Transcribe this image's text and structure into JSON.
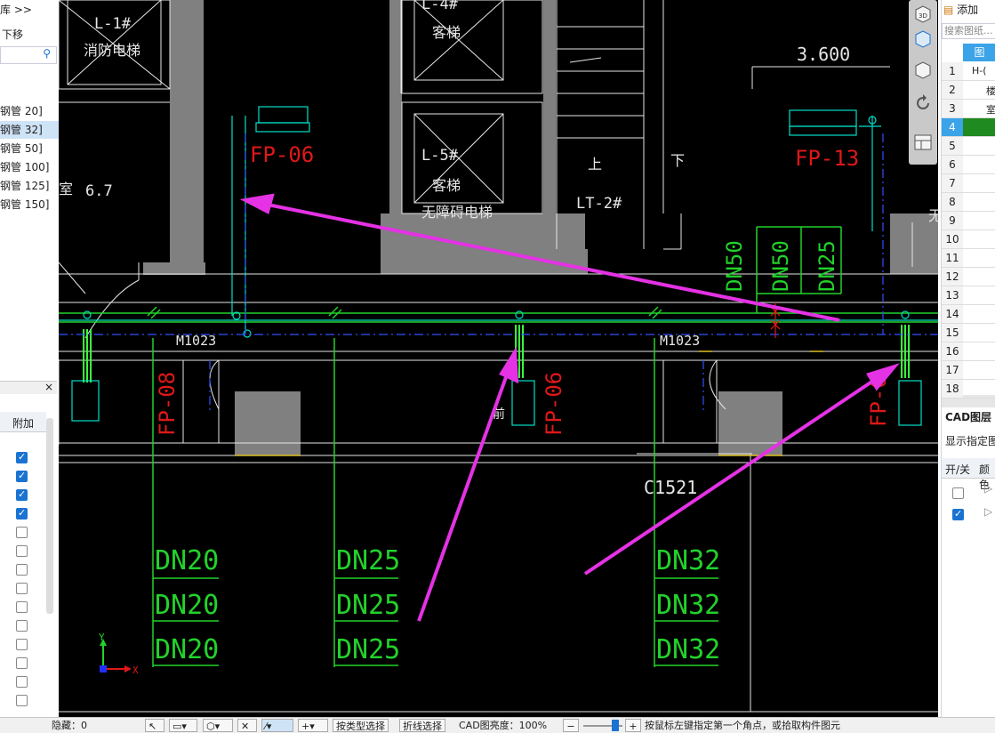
{
  "left_panel": {
    "top_text": "库 >>",
    "move_down": "下移",
    "pipes": [
      "钢管 20]",
      "钢管 32]",
      "钢管 50]",
      "钢管 100]",
      "钢管 125]",
      "钢管 150]"
    ],
    "selected_index": 1,
    "extra_col": "附加",
    "close": "×",
    "checkboxes": [
      true,
      true,
      true,
      true,
      false,
      false,
      false,
      false,
      false,
      false,
      false,
      false,
      false,
      false
    ]
  },
  "canvas": {
    "labels": {
      "l1": "L-1#",
      "l1_sub": "消防电梯",
      "l4": "L-4#",
      "l4_sub": "客梯",
      "l5": "L-5#",
      "l5_sub1": "客梯",
      "l5_sub2": "无障碍电梯",
      "lt2": "LT-2#",
      "up": "上",
      "down": "下",
      "elev": "3.600",
      "room": "室",
      "room_num": "6.7",
      "m1023a": "M1023",
      "m1023b": "M1023",
      "c1521": "C1521",
      "fp06a": "FP-06",
      "fp13": "FP-13",
      "fp08": "FP-08",
      "fp06b": "FP-06",
      "fp0x": "FP-0",
      "dn50a": "DN50",
      "dn50b": "DN50",
      "dn25v": "DN25",
      "col1": [
        "DN20",
        "DN20",
        "DN20"
      ],
      "col2": [
        "DN25",
        "DN25",
        "DN25"
      ],
      "col3": [
        "DN32",
        "DN32",
        "DN32"
      ],
      "axis_y": "Y",
      "axis_x": "X",
      "right_cut": "无",
      "small_label": "前"
    },
    "colors": {
      "bg": "#000000",
      "wall": "#808080",
      "cyan": "#00e0c8",
      "green": "#22d22a",
      "red": "#e01818",
      "magenta": "#e432e4",
      "white": "#e6e6e6"
    }
  },
  "right_panel": {
    "add": "添加",
    "search_placeholder": "搜索图纸...",
    "header": "图",
    "rows": [
      "1",
      "2",
      "3",
      "4",
      "5",
      "6",
      "7",
      "8",
      "9",
      "10",
      "11",
      "12",
      "13",
      "14",
      "15",
      "16",
      "17",
      "18"
    ],
    "tree_row1": "H-(",
    "tree_row2": "楼",
    "tree_row3": "室",
    "cad_layer": "CAD图层",
    "show_layer": "显示指定图",
    "col_onoff": "开/关",
    "col_color": "颜色"
  },
  "status": {
    "hidden": "隐藏：0",
    "btn_layer_select": "按类型选择",
    "btn_poly_select": "折线选择",
    "cad_brightness": "CAD图亮度：100%",
    "hint": "按鼠标左键指定第一个角点，或拾取构件图元"
  }
}
